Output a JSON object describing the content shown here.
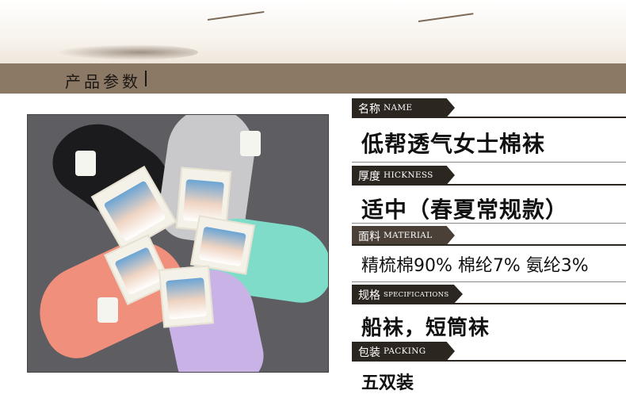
{
  "header": {
    "title": "产品参数"
  },
  "specs": [
    {
      "cn": "名称",
      "en": "NAME",
      "value": "低帮透气女士棉袜"
    },
    {
      "cn": "厚度",
      "en": "HICKNESS",
      "value": "适中（春夏常规款）"
    },
    {
      "cn": "面料",
      "en": "MATERIAL",
      "value": "精梳棉90% 棉纶7% 氨纶3%"
    },
    {
      "cn": "规格",
      "en": "SPECIFICATIONS",
      "value": "船袜，短筒袜"
    },
    {
      "cn": "包装",
      "en": "PACKING",
      "value": "五双装"
    }
  ],
  "colors": {
    "title_bar": "#8b7966",
    "label_bar": "#2c2621"
  }
}
